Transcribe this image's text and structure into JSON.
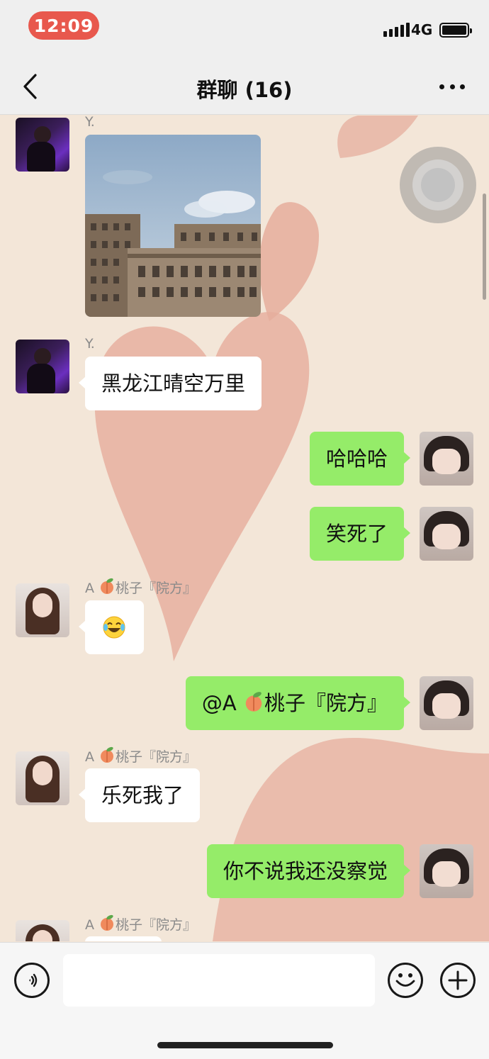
{
  "status_bar": {
    "time": "12:09",
    "network": "4G"
  },
  "header": {
    "title": "群聊 (16)"
  },
  "messages": [
    {
      "sender": "Y.",
      "type": "image"
    },
    {
      "sender": "Y.",
      "text": "黑龙江晴空万里"
    },
    {
      "sender": "me",
      "text": "哈哈哈"
    },
    {
      "sender": "me",
      "text": "笑死了"
    },
    {
      "sender_prefix": "A",
      "sender_suffix": "桃子『院方』",
      "type": "emoji",
      "emoji": "laughing-tears"
    },
    {
      "sender": "me",
      "text_prefix": "@A",
      "text_suffix": "桃子『院方』"
    },
    {
      "sender_prefix": "A",
      "sender_suffix": "桃子『院方』",
      "text": "乐死我了"
    },
    {
      "sender": "me",
      "text": "你不说我还没察觉"
    },
    {
      "sender_prefix": "A",
      "sender_suffix": "桃子『院方』"
    }
  ],
  "input": {
    "value": ""
  },
  "colors": {
    "time_pill": "#e8584d",
    "outgoing_bubble": "#95ec69",
    "incoming_bubble": "#ffffff",
    "chat_background": "#f3e6d8"
  }
}
